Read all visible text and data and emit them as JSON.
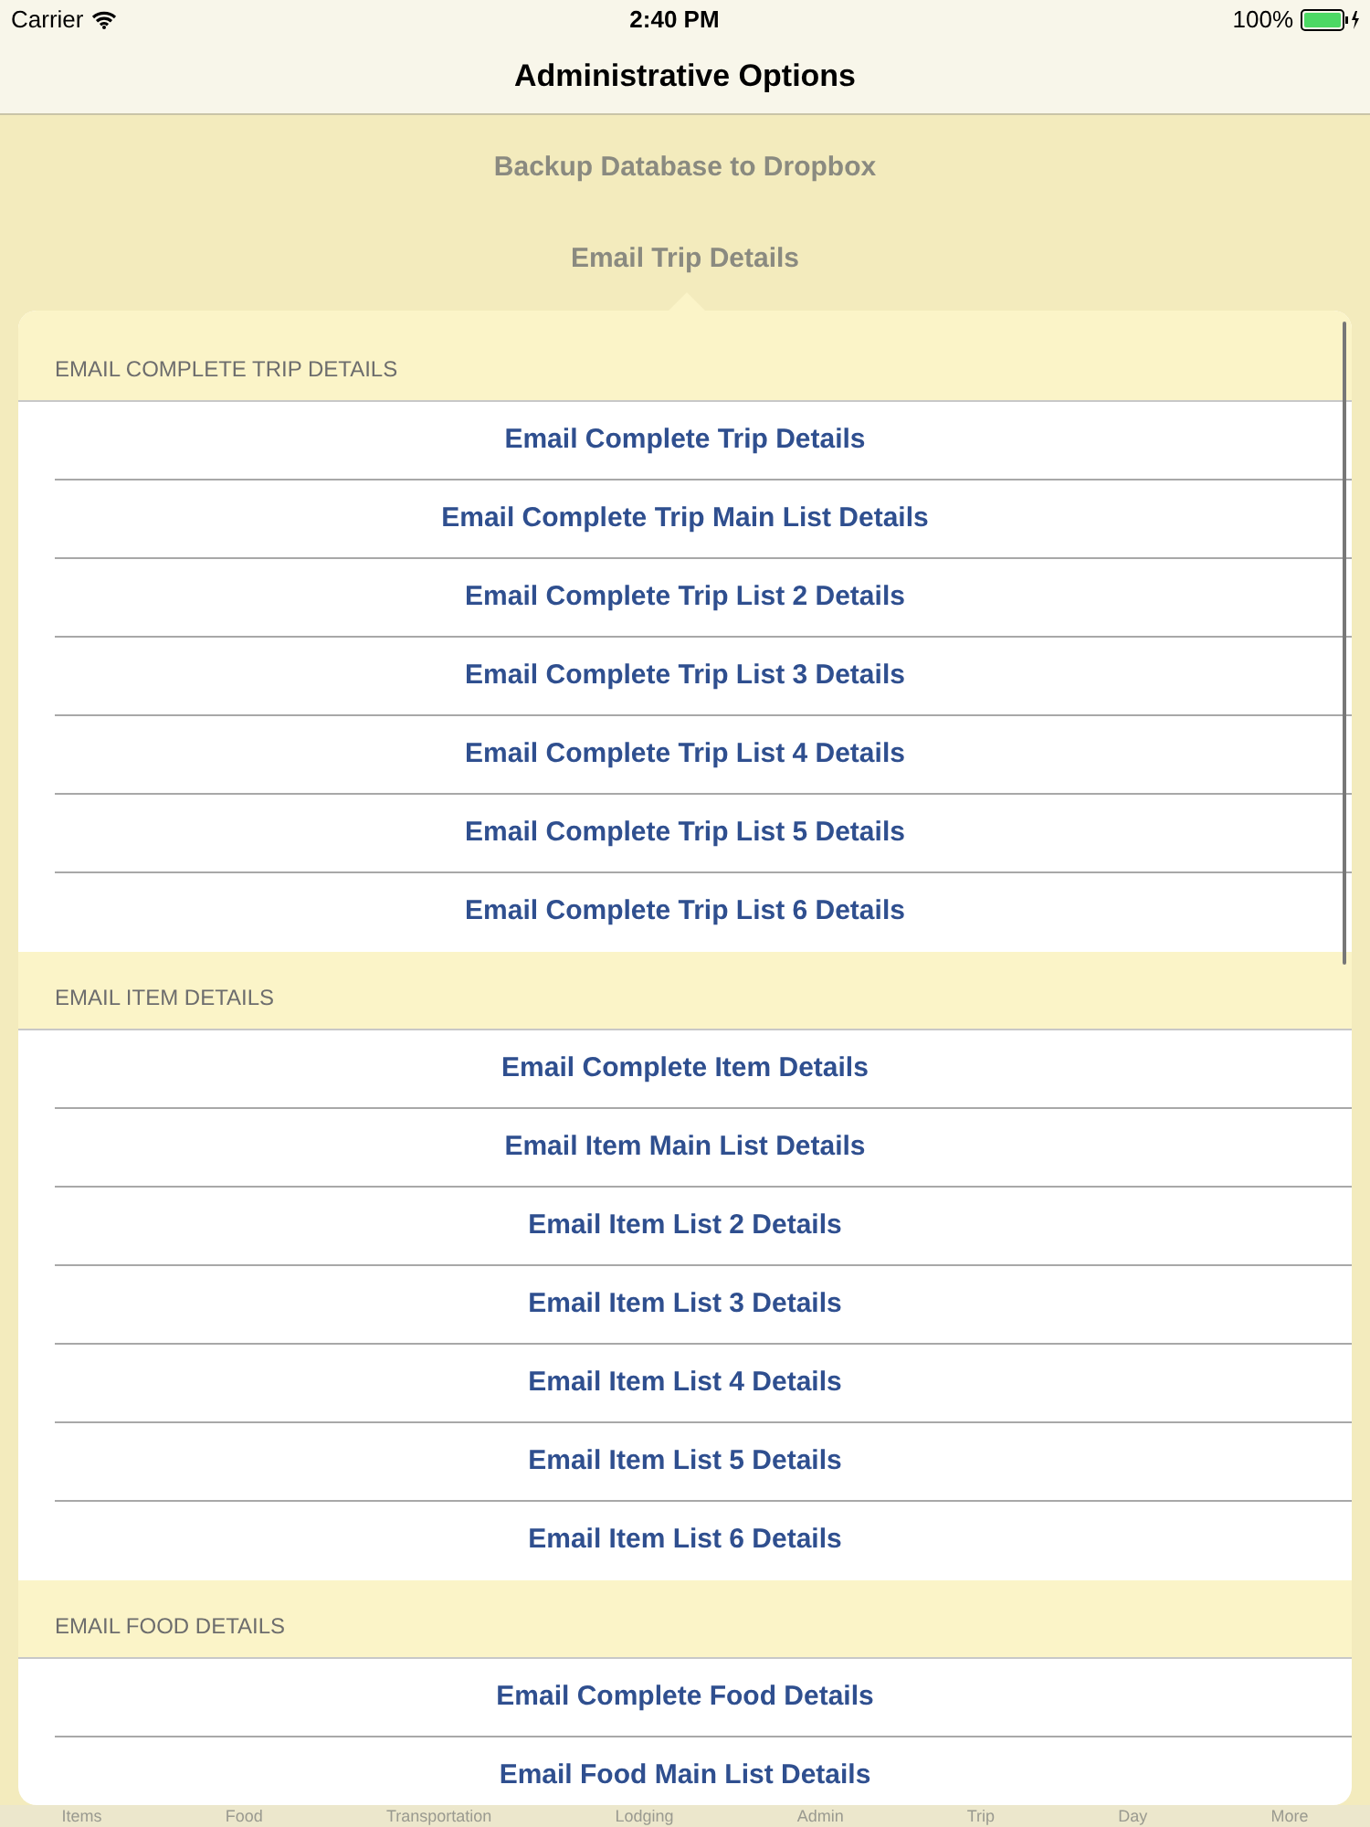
{
  "status_bar": {
    "carrier": "Carrier",
    "time": "2:40 PM",
    "battery": "100%"
  },
  "nav": {
    "title": "Administrative Options"
  },
  "actions": [
    "Backup Database to Dropbox",
    "Email Trip Details"
  ],
  "popover": {
    "sections": [
      {
        "header": "EMAIL COMPLETE TRIP DETAILS",
        "rows": [
          "Email Complete Trip Details",
          "Email Complete Trip Main List Details",
          "Email Complete Trip List 2 Details",
          "Email Complete Trip List 3 Details",
          "Email Complete Trip List 4 Details",
          "Email Complete Trip List 5 Details",
          "Email Complete Trip List 6 Details"
        ]
      },
      {
        "header": "EMAIL ITEM DETAILS",
        "rows": [
          "Email Complete Item Details",
          "Email Item Main List Details",
          "Email Item List 2 Details",
          "Email Item List 3 Details",
          "Email Item List 4 Details",
          "Email Item List 5 Details",
          "Email Item List 6 Details"
        ]
      },
      {
        "header": "EMAIL FOOD DETAILS",
        "rows": [
          "Email Complete Food Details",
          "Email Food Main List Details"
        ]
      }
    ]
  },
  "tab_bar": [
    "Items",
    "Food",
    "Transportation",
    "Lodging",
    "Admin",
    "Trip",
    "Day",
    "More"
  ]
}
